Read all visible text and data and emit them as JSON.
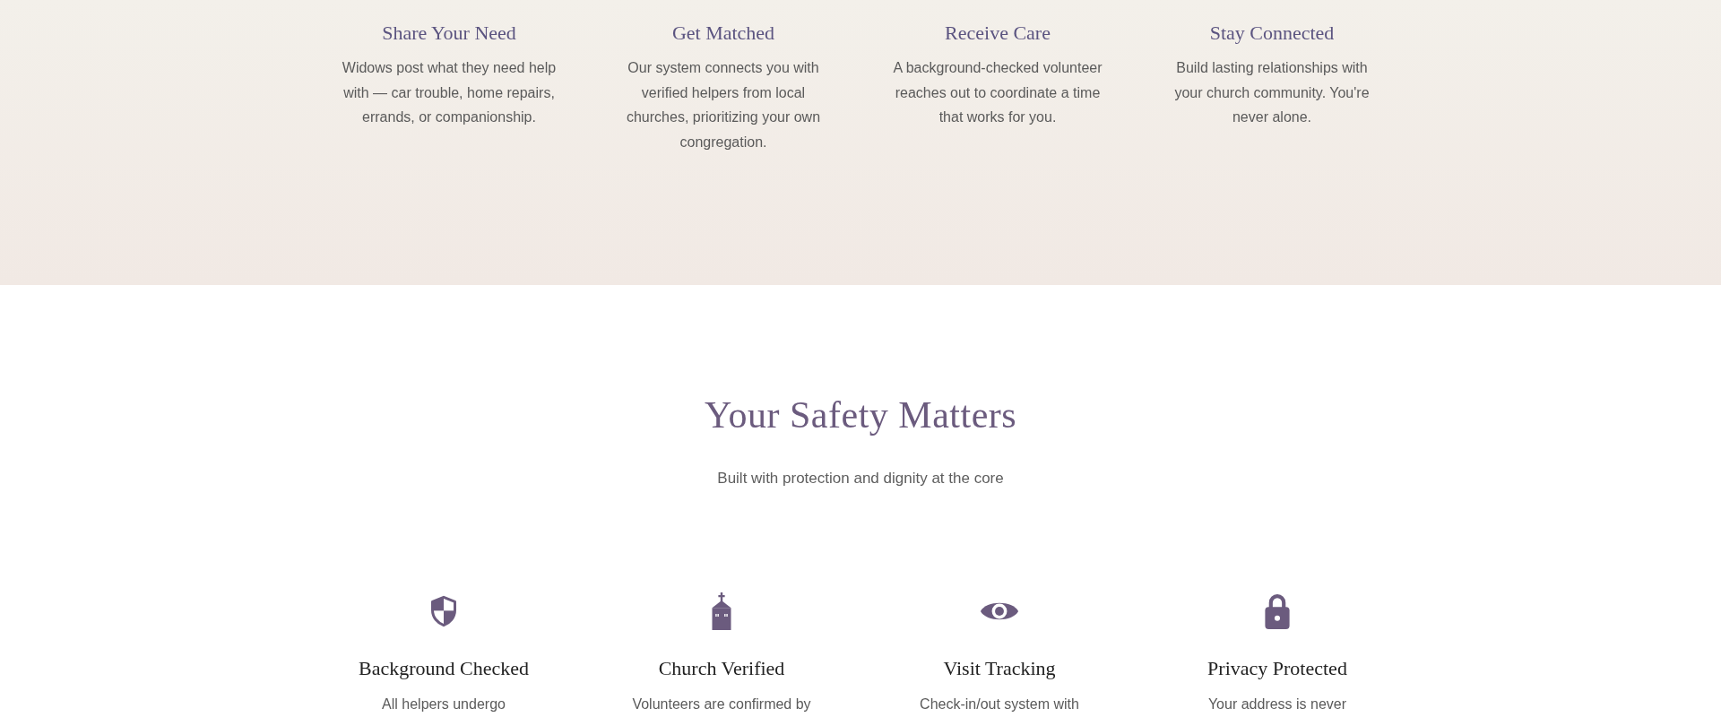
{
  "steps": [
    {
      "title": "Share Your Need",
      "description": "Widows post what they need help with — car trouble, home repairs, errands, or companionship."
    },
    {
      "title": "Get Matched",
      "description": "Our system connects you with verified helpers from local churches, prioritizing your own congregation."
    },
    {
      "title": "Receive Care",
      "description": "A background-checked volunteer reaches out to coordinate a time that works for you."
    },
    {
      "title": "Stay Connected",
      "description": "Build lasting relationships with your church community. You're never alone."
    }
  ],
  "safety": {
    "heading": "Your Safety Matters",
    "subtitle": "Built with protection and dignity at the core",
    "features": [
      {
        "kind": "shield",
        "title": "Background Checked",
        "description": "All helpers undergo"
      },
      {
        "kind": "church",
        "title": "Church Verified",
        "description": "Volunteers are confirmed by"
      },
      {
        "kind": "eye",
        "title": "Visit Tracking",
        "description": "Check-in/out system with"
      },
      {
        "kind": "lock",
        "title": "Privacy Protected",
        "description": "Your address is never"
      }
    ]
  }
}
